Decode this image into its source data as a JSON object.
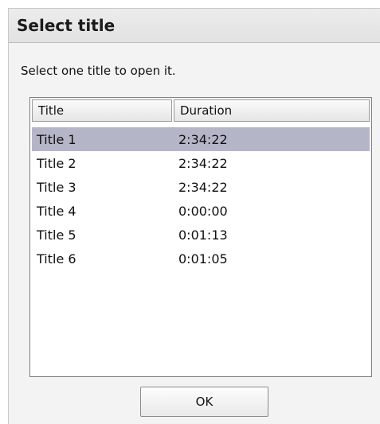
{
  "dialog": {
    "title": "Select title",
    "instruction": "Select one title to open it.",
    "ok_label": "OK"
  },
  "list": {
    "columns": [
      "Title",
      "Duration"
    ],
    "selected_index": 0,
    "rows": [
      {
        "title": "Title 1",
        "duration": "2:34:22"
      },
      {
        "title": "Title 2",
        "duration": "2:34:22"
      },
      {
        "title": "Title 3",
        "duration": "2:34:22"
      },
      {
        "title": "Title 4",
        "duration": "0:00:00"
      },
      {
        "title": "Title 5",
        "duration": "0:01:13"
      },
      {
        "title": "Title 6",
        "duration": "0:01:05"
      }
    ]
  },
  "colors": {
    "selection": "#b5b5c8",
    "dialog_background": "#f3f3f3",
    "title_bar": "#e6e6e6"
  }
}
